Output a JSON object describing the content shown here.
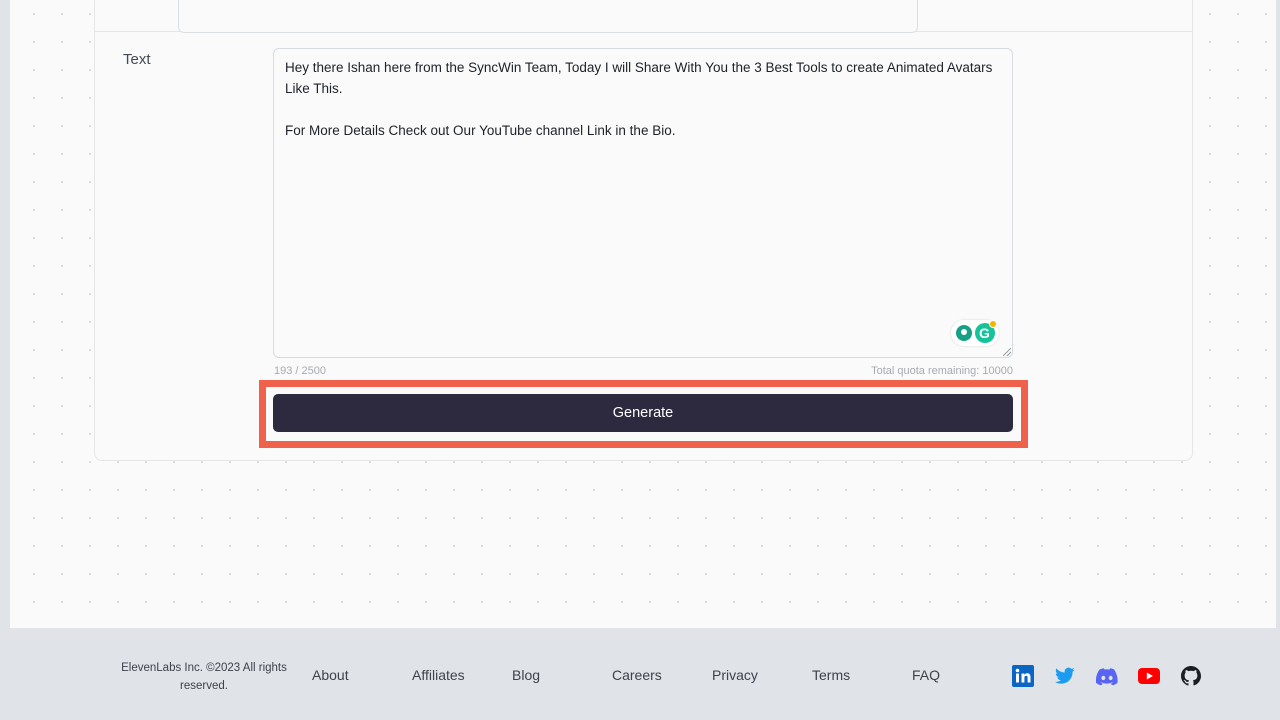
{
  "form": {
    "text_label": "Text",
    "text_value": "Hey there Ishan here from the SyncWin Team, Today I will Share With You the 3 Best Tools to create Animated Avatars Like This.\n\nFor More Details Check out Our YouTube channel Link in the Bio.",
    "char_count": "193 / 2500",
    "quota": "Total quota remaining: 10000",
    "generate_label": "Generate"
  },
  "footer": {
    "copyright": "ElevenLabs Inc. ©2023 All rights reserved.",
    "links": [
      "About",
      "Affiliates",
      "Blog",
      "Careers",
      "Privacy",
      "Terms",
      "FAQ"
    ],
    "social_icons": [
      "linkedin-icon",
      "twitter-icon",
      "discord-icon",
      "youtube-icon",
      "github-icon"
    ]
  },
  "colors": {
    "generate_button": "#2d2a3f",
    "highlight": "#f0614b",
    "linkedin": "#0a66c2",
    "twitter": "#1d9bf0",
    "discord": "#5865f2",
    "youtube": "#ff0000",
    "github": "#1b1f23"
  }
}
